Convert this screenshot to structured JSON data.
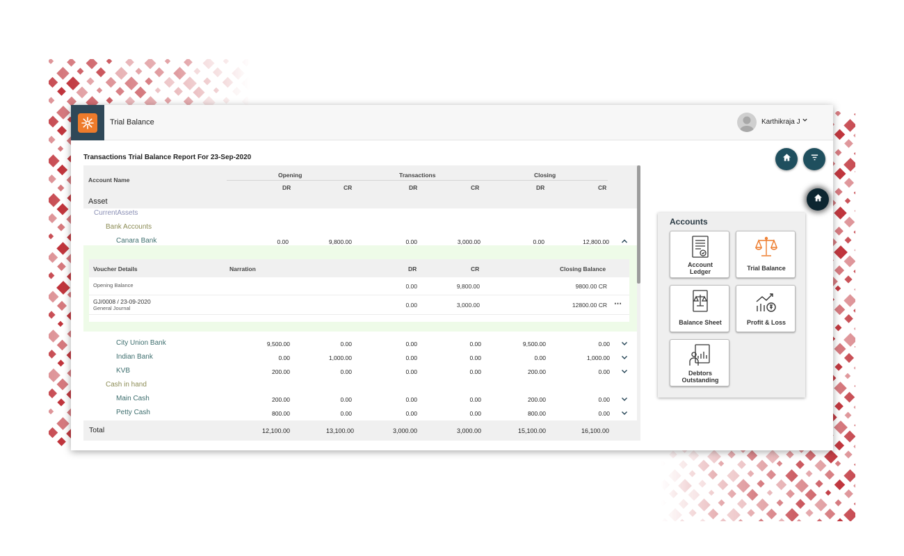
{
  "app": {
    "title": "Trial Balance"
  },
  "user": {
    "name": "Karthikraja J"
  },
  "report": {
    "title": "Transactions Trial Balance Report For 23-Sep-2020",
    "columns": {
      "account_name": "Account Name",
      "opening": "Opening",
      "transactions": "Transactions",
      "closing": "Closing",
      "dr": "DR",
      "cr": "CR"
    },
    "group": "Asset",
    "sub_group": "CurrentAssets",
    "bank_group": "Bank Accounts",
    "cash_group": "Cash in hand",
    "rows": [
      {
        "name": "Canara Bank",
        "op_dr": "0.00",
        "op_cr": "9,800.00",
        "tr_dr": "0.00",
        "tr_cr": "3,000.00",
        "cl_dr": "0.00",
        "cl_cr": "12,800.00"
      },
      {
        "name": "City Union Bank",
        "op_dr": "9,500.00",
        "op_cr": "0.00",
        "tr_dr": "0.00",
        "tr_cr": "0.00",
        "cl_dr": "9,500.00",
        "cl_cr": "0.00"
      },
      {
        "name": "Indian Bank",
        "op_dr": "0.00",
        "op_cr": "1,000.00",
        "tr_dr": "0.00",
        "tr_cr": "0.00",
        "cl_dr": "0.00",
        "cl_cr": "1,000.00"
      },
      {
        "name": "KVB",
        "op_dr": "200.00",
        "op_cr": "0.00",
        "tr_dr": "0.00",
        "tr_cr": "0.00",
        "cl_dr": "200.00",
        "cl_cr": "0.00"
      },
      {
        "name": "Main Cash",
        "op_dr": "200.00",
        "op_cr": "0.00",
        "tr_dr": "0.00",
        "tr_cr": "0.00",
        "cl_dr": "200.00",
        "cl_cr": "0.00"
      },
      {
        "name": "Petty Cash",
        "op_dr": "800.00",
        "op_cr": "0.00",
        "tr_dr": "0.00",
        "tr_cr": "0.00",
        "cl_dr": "800.00",
        "cl_cr": "0.00"
      }
    ],
    "detail": {
      "headers": {
        "voucher": "Voucher Details",
        "narration": "Narration",
        "dr": "DR",
        "cr": "CR",
        "closing": "Closing Balance"
      },
      "rows": [
        {
          "voucher": "Opening Balance",
          "sub": "",
          "dr": "0.00",
          "cr": "9,800.00",
          "closing": "9800.00 CR"
        },
        {
          "voucher": "GJ/0008 / 23-09-2020",
          "sub": "General Journal",
          "dr": "0.00",
          "cr": "3,000.00",
          "closing": "12800.00 CR"
        }
      ]
    },
    "total": {
      "label": "Total",
      "op_dr": "12,100.00",
      "op_cr": "13,100.00",
      "tr_dr": "3,000.00",
      "tr_cr": "3,000.00",
      "cl_dr": "15,100.00",
      "cl_cr": "16,100.00"
    }
  },
  "accounts_panel": {
    "title": "Accounts",
    "items": [
      {
        "label1": "Account",
        "label2": "Ledger",
        "icon": "ledger-icon"
      },
      {
        "label1": "Trial Balance",
        "label2": "",
        "icon": "scale-icon"
      },
      {
        "label1": "Balance Sheet",
        "label2": "",
        "icon": "balance-sheet-icon"
      },
      {
        "label1": "Profit & Loss",
        "label2": "",
        "icon": "profit-loss-icon"
      },
      {
        "label1": "Debtors",
        "label2": "Outstanding",
        "icon": "debtors-icon"
      }
    ]
  },
  "colors": {
    "brand_dark": "#2f4858",
    "brand_orange": "#ee7b2b",
    "fab": "#1f4f5e",
    "account_link": "#3d6e6e",
    "decor_red": "#b5121b"
  }
}
